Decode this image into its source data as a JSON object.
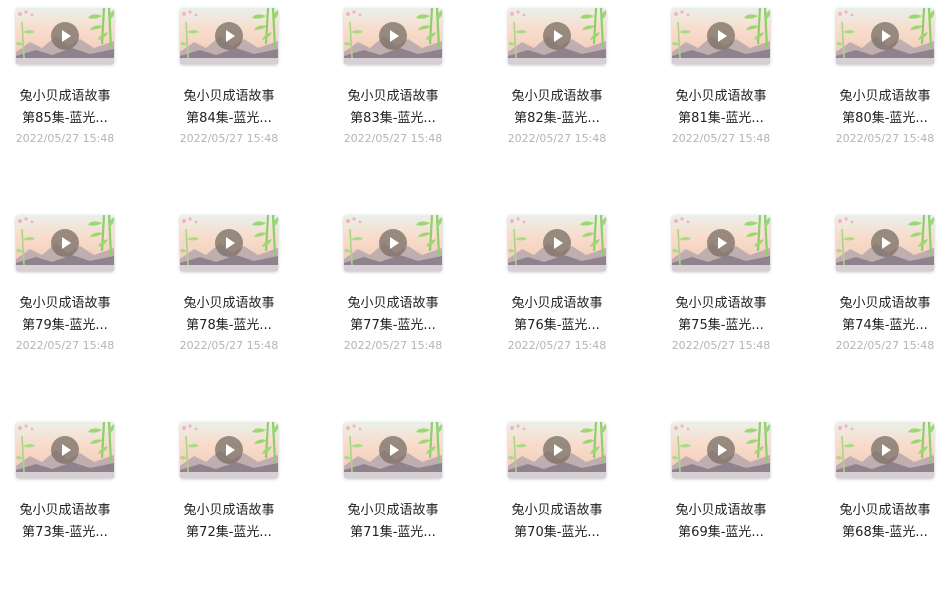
{
  "files": [
    {
      "title_line1": "兔小贝成语故事",
      "title_line2": "第85集-蓝光...",
      "date": "2022/05/27 15:48"
    },
    {
      "title_line1": "兔小贝成语故事",
      "title_line2": "第84集-蓝光...",
      "date": "2022/05/27 15:48"
    },
    {
      "title_line1": "兔小贝成语故事",
      "title_line2": "第83集-蓝光...",
      "date": "2022/05/27 15:48"
    },
    {
      "title_line1": "兔小贝成语故事",
      "title_line2": "第82集-蓝光...",
      "date": "2022/05/27 15:48"
    },
    {
      "title_line1": "兔小贝成语故事",
      "title_line2": "第81集-蓝光...",
      "date": "2022/05/27 15:48"
    },
    {
      "title_line1": "兔小贝成语故事",
      "title_line2": "第80集-蓝光...",
      "date": "2022/05/27 15:48"
    },
    {
      "title_line1": "兔小贝成语故事",
      "title_line2": "第79集-蓝光...",
      "date": "2022/05/27 15:48"
    },
    {
      "title_line1": "兔小贝成语故事",
      "title_line2": "第78集-蓝光...",
      "date": "2022/05/27 15:48"
    },
    {
      "title_line1": "兔小贝成语故事",
      "title_line2": "第77集-蓝光...",
      "date": "2022/05/27 15:48"
    },
    {
      "title_line1": "兔小贝成语故事",
      "title_line2": "第76集-蓝光...",
      "date": "2022/05/27 15:48"
    },
    {
      "title_line1": "兔小贝成语故事",
      "title_line2": "第75集-蓝光...",
      "date": "2022/05/27 15:48"
    },
    {
      "title_line1": "兔小贝成语故事",
      "title_line2": "第74集-蓝光...",
      "date": "2022/05/27 15:48"
    },
    {
      "title_line1": "兔小贝成语故事",
      "title_line2": "第73集-蓝光...",
      "date": ""
    },
    {
      "title_line1": "兔小贝成语故事",
      "title_line2": "第72集-蓝光...",
      "date": ""
    },
    {
      "title_line1": "兔小贝成语故事",
      "title_line2": "第71集-蓝光...",
      "date": ""
    },
    {
      "title_line1": "兔小贝成语故事",
      "title_line2": "第70集-蓝光...",
      "date": ""
    },
    {
      "title_line1": "兔小贝成语故事",
      "title_line2": "第69集-蓝光...",
      "date": ""
    },
    {
      "title_line1": "兔小贝成语故事",
      "title_line2": "第68集-蓝光...",
      "date": ""
    }
  ],
  "icons": {
    "play": "play-icon",
    "thumbnail": "video-thumbnail"
  },
  "colors": {
    "title_text": "#222222",
    "date_text": "#b4b4b4",
    "bamboo": "#8fce6a",
    "mountain": "#9a8f98",
    "sky": "#f7dcc9"
  }
}
